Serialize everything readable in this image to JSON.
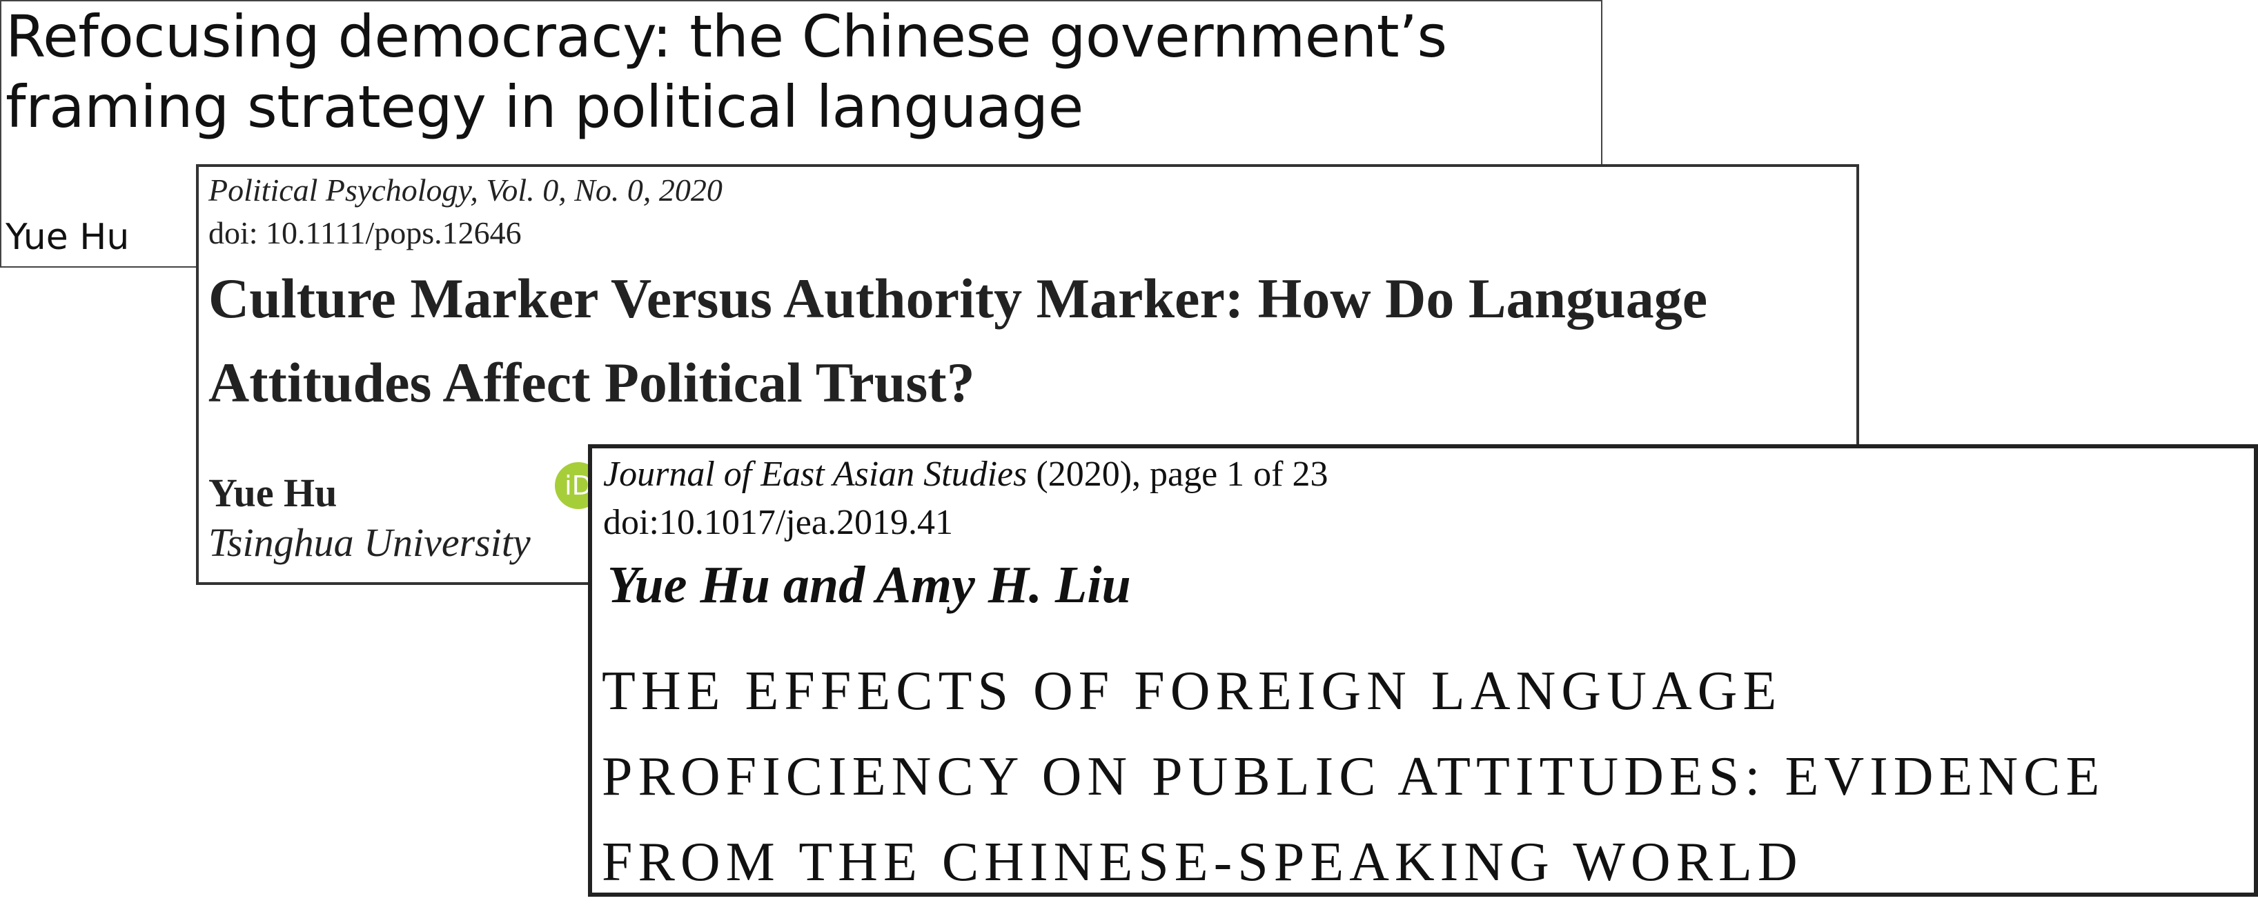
{
  "papers": [
    {
      "title": "Refocusing democracy: the Chinese government’s framing strategy in political language",
      "author": "Yue Hu"
    },
    {
      "journal": "Political Psychology, Vol. 0, No. 0, 2020",
      "doi": "doi: 10.1111/pops.12646",
      "title": "Culture Marker Versus Authority Marker: How Do Language Attitudes Affect Political Trust?",
      "author": "Yue Hu",
      "orcid_badge": "iD",
      "affiliation": "Tsinghua University"
    },
    {
      "journal_name": "Journal of East Asian Studies",
      "journal_suffix": " (2020), page 1 of 23",
      "doi": "doi:10.1017/jea.2019.41",
      "authors": "Yue Hu and Amy H. Liu",
      "title": "THE EFFECTS OF FOREIGN LANGUAGE\nPROFICIENCY ON PUBLIC ATTITUDES: EVIDENCE\nFROM THE CHINESE-SPEAKING WORLD"
    }
  ],
  "colors": {
    "orcid_green": "#a6ce39",
    "text": "#111111",
    "border": "#222222"
  }
}
